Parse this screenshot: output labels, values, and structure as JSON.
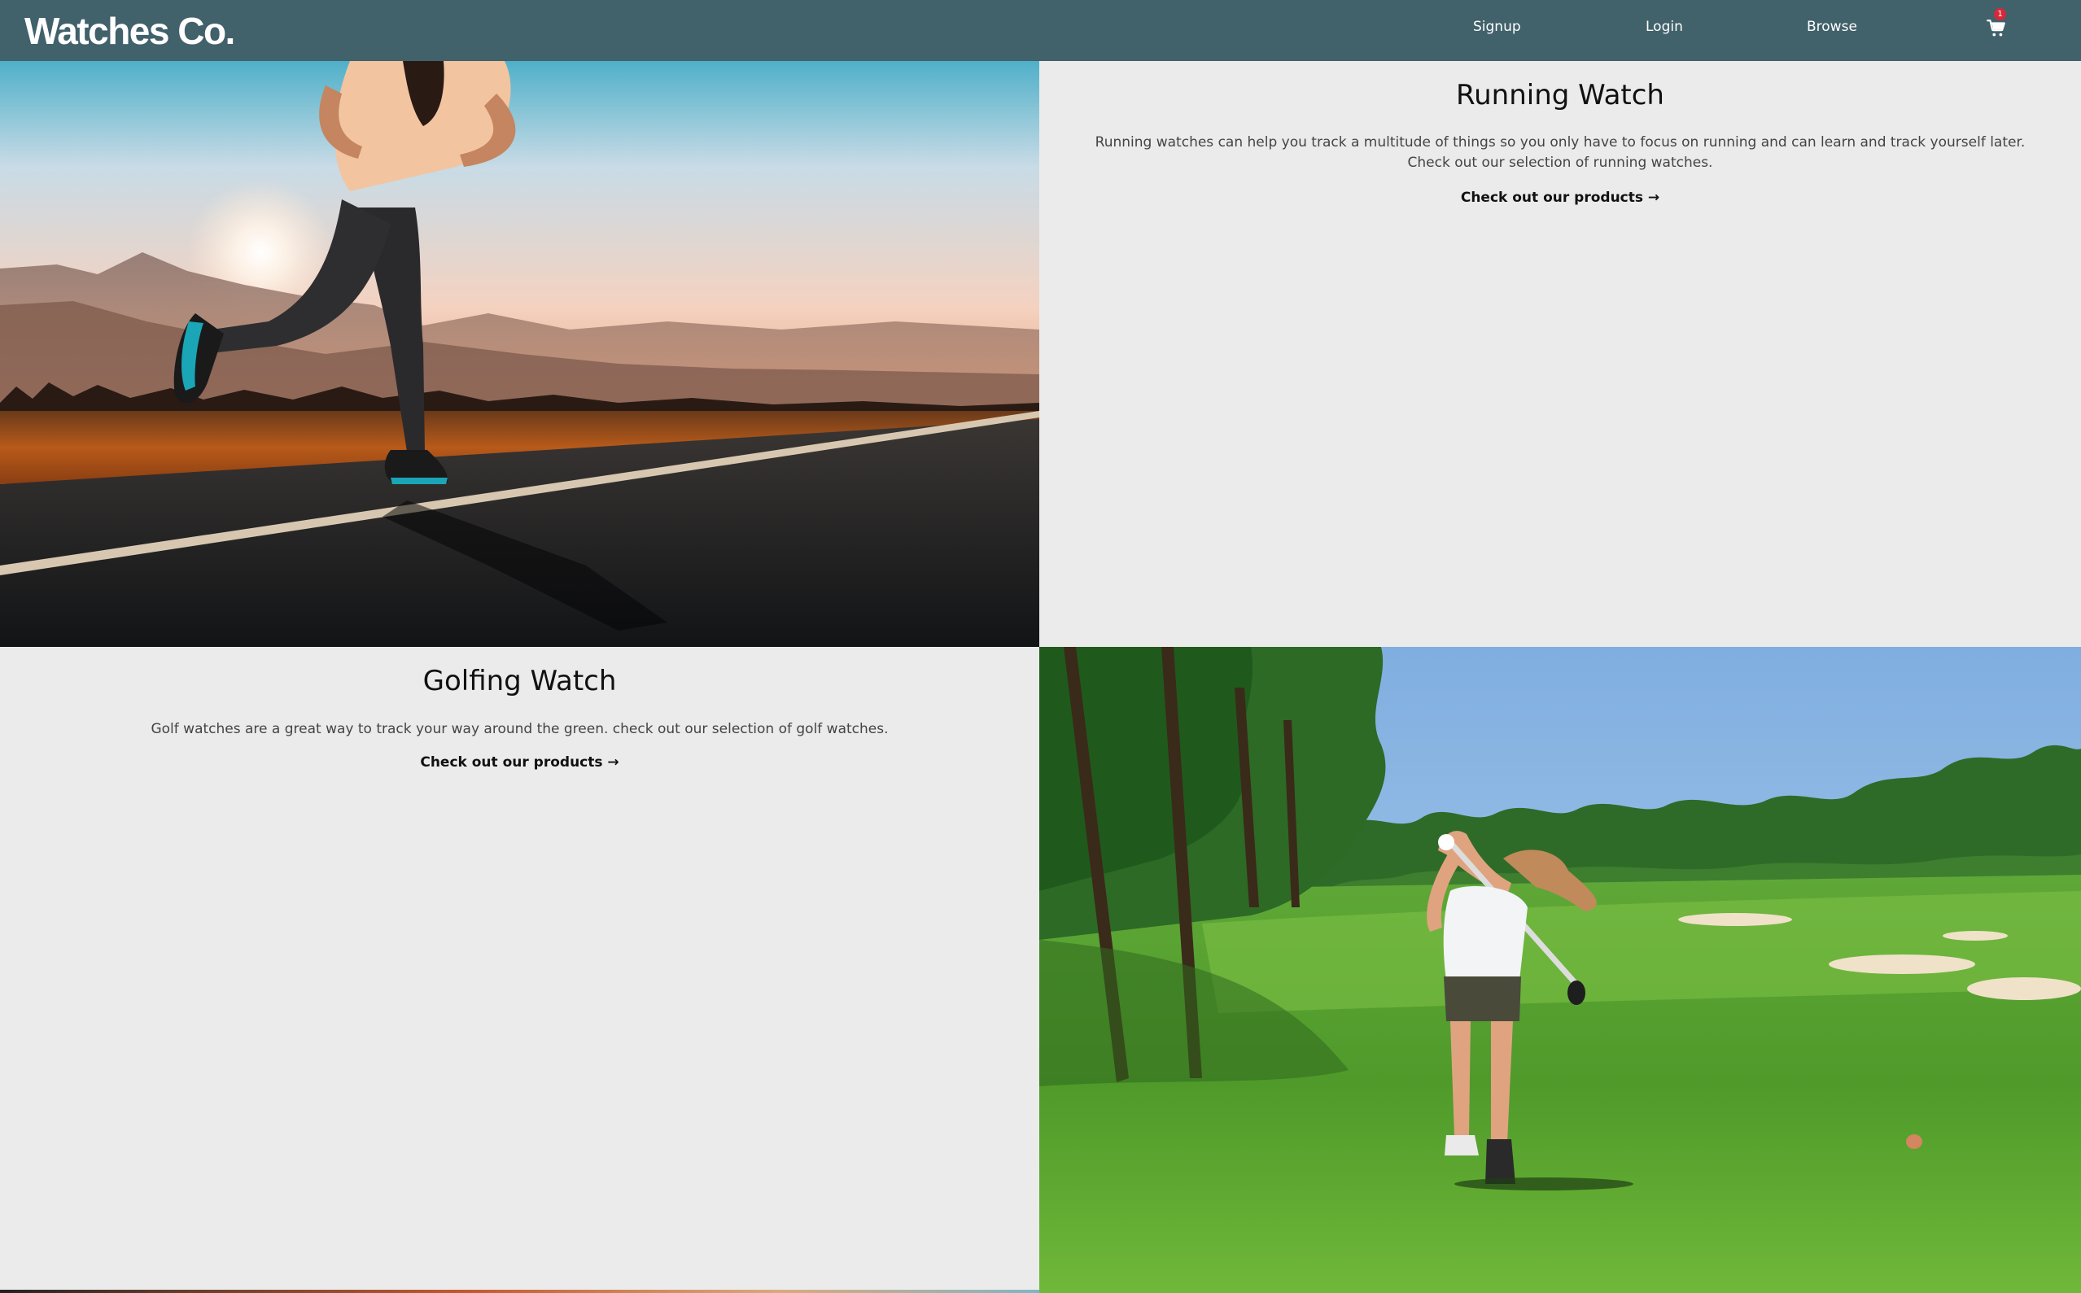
{
  "header": {
    "brand": "Watches Co.",
    "nav": {
      "signup": "Signup",
      "login": "Login",
      "browse": "Browse"
    },
    "cart": {
      "icon": "cart-icon",
      "count": "1"
    },
    "colors": {
      "background": "#41616b",
      "badge": "#d62839"
    }
  },
  "sections": {
    "running": {
      "title": "Running Watch",
      "description": "Running watches can help you track a multitude of things so you only have to focus on running and can learn and track yourself later. Check out our selection of running watches.",
      "link": "Check out our products →",
      "image": "runner-photo"
    },
    "golf": {
      "title": "Golfing Watch",
      "description": "Golf watches are a great way to track your way around the green. check out our selection of golf watches.",
      "link": "Check out our products →",
      "image": "golfer-photo"
    }
  }
}
